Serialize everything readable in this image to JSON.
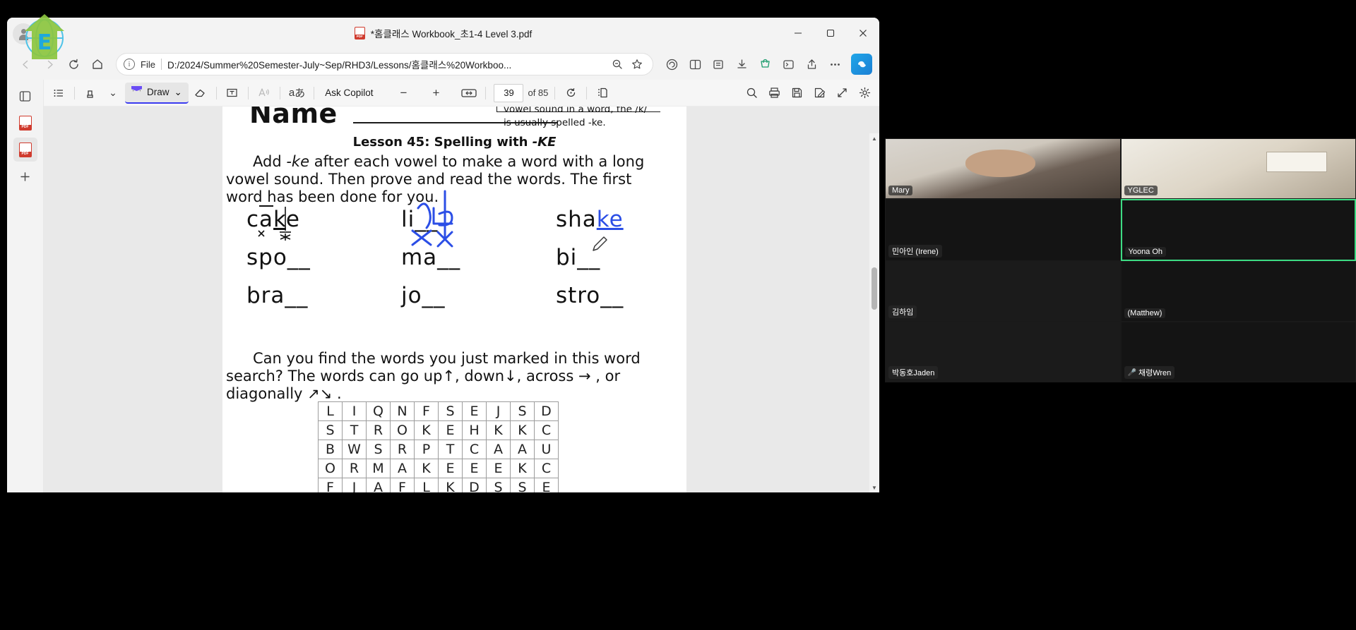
{
  "window": {
    "tab_title": "*홈클래스 Workbook_초1-4 Level 3.pdf",
    "minimize": "−",
    "maximize": "❐",
    "close": "✕"
  },
  "nav": {
    "back_icon": "back-arrow-icon",
    "forward_icon": "forward-arrow-icon",
    "refresh_icon": "refresh-icon",
    "home_icon": "home-icon",
    "info_icon": "i",
    "file_label": "File",
    "url": "D:/2024/Summer%20Semester-July~Sep/RHD3/Lessons/홈클래스%20Workboo...",
    "zoom_icon": "zoom-out-icon",
    "favorite_icon": "star-icon",
    "icons": [
      "copilot-circle-icon",
      "split-screen-icon",
      "collections-icon",
      "downloads-icon",
      "shopping-icon",
      "browser-essentials-icon",
      "share-icon",
      "settings-more-icon"
    ]
  },
  "pdf_sidebar": {
    "toggle_icon": "page-list-toggle-icon",
    "items": [
      {
        "icon": "pdf-thumbnail-icon",
        "label": ""
      },
      {
        "icon": "pdf-thumbnail-icon",
        "label": "",
        "active": true
      },
      {
        "icon": "add-icon",
        "label": "+"
      }
    ]
  },
  "pdf_toolbar": {
    "list_icon": "table-of-contents-icon",
    "highlight_icon": "highlighter-icon",
    "highlight_chevron": "⌄",
    "draw_label": "Draw",
    "draw_chevron": "⌄",
    "eraser_icon": "eraser-icon",
    "text_icon": "add-text-icon",
    "read_aloud_icon": "read-aloud-icon",
    "translate_icon": "あ",
    "translate_prefix": "a",
    "ask_copilot_label": "Ask Copilot",
    "zoom_out": "−",
    "zoom_in": "+",
    "fit_page_icon": "fit-to-width-icon",
    "page_number": "39",
    "page_total": "of 85",
    "rotate_icon": "rotate-icon",
    "layout_icon": "page-view-icon",
    "search_icon": "search-icon",
    "print_icon": "print-icon",
    "save_icon": "save-icon",
    "save_as_icon": "save-as-icon",
    "fullscreen_icon": "fullscreen-icon",
    "settings_icon": "gear-icon"
  },
  "worksheet": {
    "name_label": "Name",
    "side_note": "vowel sound in a word, the /k/ is usually spelled -ke.",
    "lesson_title_prefix": "Lesson 45: Spelling with ",
    "lesson_title_em": "-KE",
    "paragraph_1_a": "Add ",
    "paragraph_1_em": "-ke",
    "paragraph_1_b": " after each vowel to make a word with a long vowel sound. Then prove and read the words. The first word has been done for you.",
    "paragraph_2": "Can you find the words you just marked in this word search? The words can go up↑, down↓, across → , or diagonally ↗↘ .",
    "word_rows": [
      [
        "cake",
        "li__",
        "sha"
      ],
      [
        "spo__",
        "ma__",
        "bi__"
      ],
      [
        "bra__",
        "jo__",
        "stro__"
      ]
    ],
    "ink_answer": "ke",
    "word_search": [
      [
        "L",
        "I",
        "Q",
        "N",
        "F",
        "S",
        "E",
        "J",
        "S",
        "D"
      ],
      [
        "S",
        "T",
        "R",
        "O",
        "K",
        "E",
        "H",
        "K",
        "K",
        "C"
      ],
      [
        "B",
        "W",
        "S",
        "R",
        "P",
        "T",
        "C",
        "A",
        "A",
        "U"
      ],
      [
        "O",
        "R",
        "M",
        "A",
        "K",
        "E",
        "E",
        "E",
        "K",
        "C"
      ],
      [
        "F",
        "J",
        "A",
        "F",
        "L",
        "K",
        "D",
        "S",
        "S",
        "E"
      ]
    ]
  },
  "video": {
    "participants": [
      {
        "name": "Mary",
        "style": "v-mary",
        "muted": false
      },
      {
        "name": "YGLEC",
        "style": "v-room",
        "muted": false
      },
      {
        "name": "민아인 (Irene)",
        "style": "v-dark",
        "muted": false
      },
      {
        "name": "Yoona Oh",
        "style": "v-dark",
        "muted": false,
        "active": true
      },
      {
        "name": "김하임",
        "style": "v-grey",
        "muted": false
      },
      {
        "name": "(Matthew)",
        "style": "v-dark",
        "muted": false
      },
      {
        "name": "박동호Jaden",
        "style": "v-grey",
        "muted": false
      },
      {
        "name": "채령Wren",
        "style": "v-dark",
        "muted": true
      }
    ]
  },
  "colors": {
    "accent_blue": "#3a3af0",
    "ink_blue": "#2b4ee6",
    "pdf_red": "#d03b2e",
    "active_green": "#3ddc84"
  }
}
